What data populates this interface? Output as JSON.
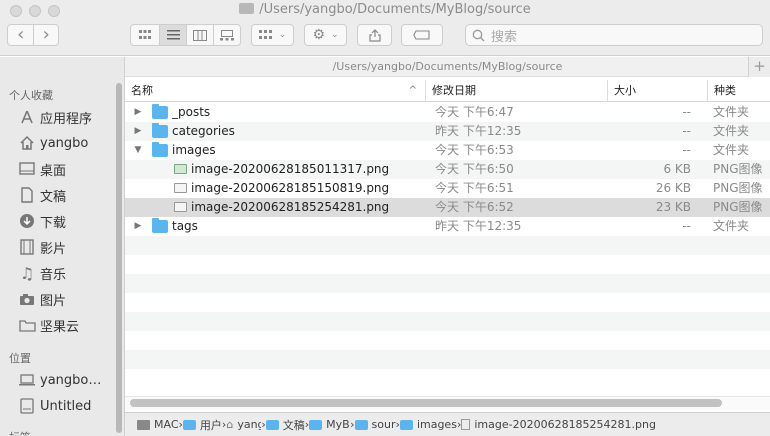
{
  "window": {
    "title": "/Users/yangbo/Documents/MyBlog/source"
  },
  "toolbar": {
    "back": "‹",
    "forward": "›",
    "share": "⇧",
    "search_placeholder": "搜索"
  },
  "pathbar": {
    "text": "/Users/yangbo/Documents/MyBlog/source",
    "plus": "+"
  },
  "sidebar": {
    "favorites_heading": "个人收藏",
    "favorites": [
      {
        "label": "应用程序",
        "icon": "apps-icon"
      },
      {
        "label": "yangbo",
        "icon": "home-icon"
      },
      {
        "label": "桌面",
        "icon": "desktop-icon"
      },
      {
        "label": "文稿",
        "icon": "documents-icon"
      },
      {
        "label": "下载",
        "icon": "download-icon"
      },
      {
        "label": "影片",
        "icon": "movies-icon"
      },
      {
        "label": "音乐",
        "icon": "music-icon"
      },
      {
        "label": "图片",
        "icon": "pictures-icon"
      },
      {
        "label": "坚果云",
        "icon": "folder-icon"
      }
    ],
    "locations_heading": "位置",
    "locations": [
      {
        "label": "yangbo…",
        "icon": "laptop-icon"
      },
      {
        "label": "Untitled",
        "icon": "disk-icon"
      }
    ],
    "partial_heading": "标签"
  },
  "columns": {
    "name": "名称",
    "date": "修改日期",
    "size": "大小",
    "kind": "种类"
  },
  "files": [
    {
      "name": "_posts",
      "date": "今天 下午6:47",
      "size": "--",
      "kind": "文件夹",
      "type": "folder",
      "disclosure": "▶",
      "level": 0
    },
    {
      "name": "categories",
      "date": "昨天 下午12:35",
      "size": "--",
      "kind": "文件夹",
      "type": "folder",
      "disclosure": "▶",
      "level": 0
    },
    {
      "name": "images",
      "date": "今天 下午6:53",
      "size": "--",
      "kind": "文件夹",
      "type": "folder",
      "disclosure": "▼",
      "level": 0
    },
    {
      "name": "image-20200628185011317.png",
      "date": "今天 下午6:50",
      "size": "6 KB",
      "kind": "PNG图像",
      "type": "png",
      "disclosure": "",
      "level": 1
    },
    {
      "name": "image-20200628185150819.png",
      "date": "今天 下午6:51",
      "size": "26 KB",
      "kind": "PNG图像",
      "type": "png",
      "disclosure": "",
      "level": 1
    },
    {
      "name": "image-20200628185254281.png",
      "date": "今天 下午6:52",
      "size": "23 KB",
      "kind": "PNG图像",
      "type": "png",
      "disclosure": "",
      "level": 1,
      "selected": true
    },
    {
      "name": "tags",
      "date": "昨天 下午12:35",
      "size": "--",
      "kind": "文件夹",
      "type": "folder",
      "disclosure": "▶",
      "level": 0
    }
  ],
  "statusbar": {
    "crumbs": [
      {
        "label": "MAC",
        "icon": "drive-icon"
      },
      {
        "label": "用户",
        "icon": "folder-icon"
      },
      {
        "label": "yangt",
        "icon": "home-icon"
      },
      {
        "label": "文稿",
        "icon": "folder-icon"
      },
      {
        "label": "MyBl",
        "icon": "folder-icon"
      },
      {
        "label": "sourc",
        "icon": "folder-icon"
      },
      {
        "label": "images",
        "icon": "folder-icon"
      },
      {
        "label": "image-20200628185254281.png",
        "icon": "file-icon"
      }
    ]
  }
}
